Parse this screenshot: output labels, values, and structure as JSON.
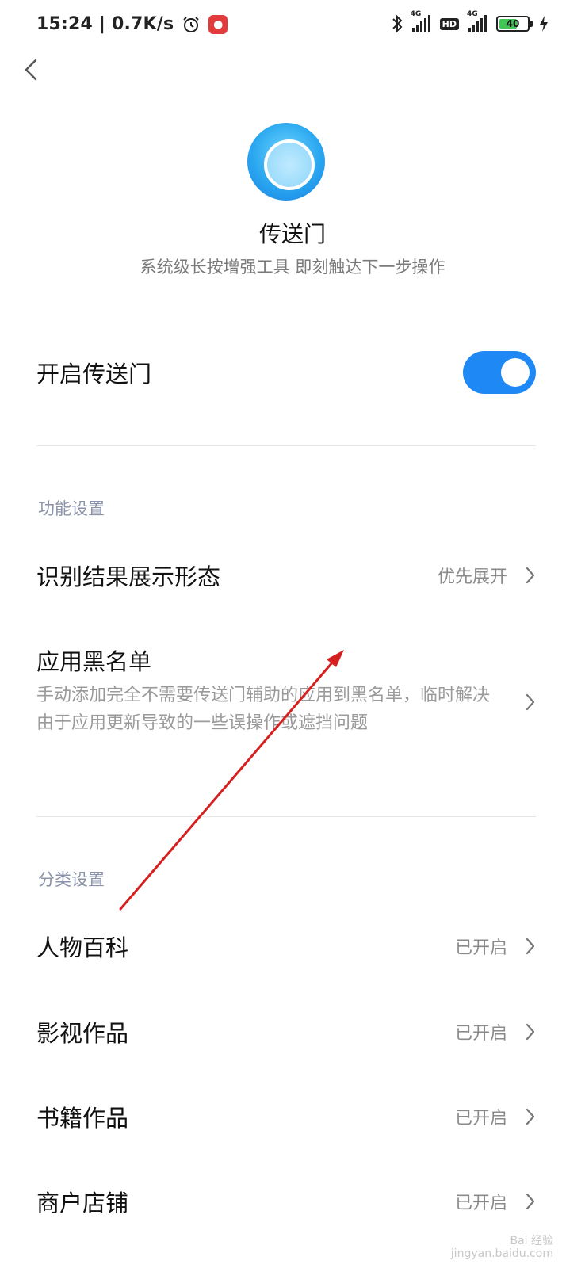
{
  "status_bar": {
    "time_speed": "15:24 | 0.7K/s",
    "battery": "40",
    "hd_label": "HD",
    "network_label_1": "4G",
    "network_label_2": "4G"
  },
  "header": {
    "title": "传送门",
    "subtitle": "系统级长按增强工具 即刻触达下一步操作"
  },
  "toggle": {
    "label": "开启传送门",
    "enabled": true
  },
  "sections": {
    "function_settings": "功能设置",
    "category_settings": "分类设置"
  },
  "function_rows": [
    {
      "label": "识别结果展示形态",
      "value": "优先展开"
    }
  ],
  "blacklist": {
    "title": "应用黑名单",
    "description": "手动添加完全不需要传送门辅助的应用到黑名单，临时解决由于应用更新导致的一些误操作或遮挡问题"
  },
  "category_rows": [
    {
      "label": "人物百科",
      "value": "已开启"
    },
    {
      "label": "影视作品",
      "value": "已开启"
    },
    {
      "label": "书籍作品",
      "value": "已开启"
    },
    {
      "label": "商户店铺",
      "value": "已开启"
    }
  ],
  "watermark": {
    "line1": "Bai 经验",
    "line2": "jingyan.baidu.com"
  },
  "colors": {
    "accent": "#1e88f5",
    "section_label": "#8a93aa",
    "annotation_arrow": "#d62020"
  },
  "icons": [
    "back-arrow-icon",
    "alarm-icon",
    "bluetooth-icon",
    "signal-icon",
    "battery-icon",
    "charging-icon",
    "chevron-right-icon"
  ]
}
